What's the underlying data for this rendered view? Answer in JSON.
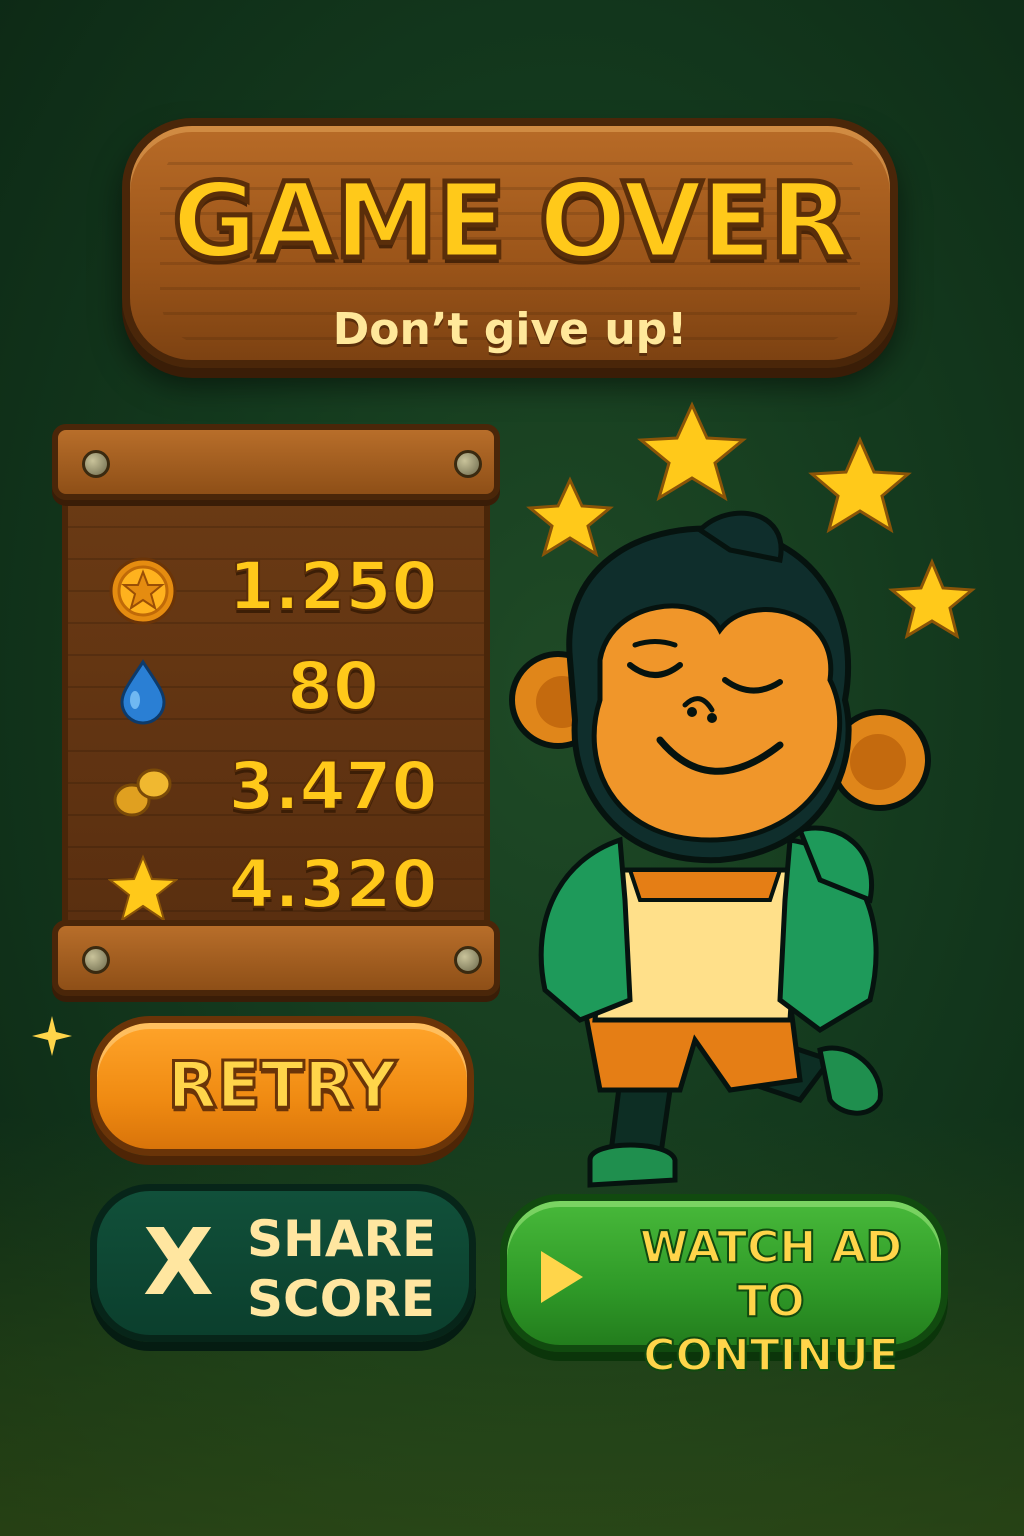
{
  "title": {
    "heading": "GAME OVER",
    "subtitle": "Don’t give up!"
  },
  "stats": [
    {
      "icon": "coin-icon",
      "value": "1.250"
    },
    {
      "icon": "water-drop-icon",
      "value": "80"
    },
    {
      "icon": "nuggets-icon",
      "value": "3.470"
    },
    {
      "icon": "star-icon",
      "value": "4.320"
    }
  ],
  "buttons": {
    "retry_label": "RETRY",
    "share_icon": "X",
    "share_line1": "SHARE",
    "share_line2": "SCORE",
    "ad_line1": "WATCH AD",
    "ad_line2": "TO CONTINUE"
  },
  "colors": {
    "accent_yellow": "#ffc91a",
    "wood": "#9a5419",
    "retry_orange": "#f08b12",
    "share_dark_green": "#0b3f2d",
    "ad_green": "#2f9a28",
    "background": "#143a1e"
  }
}
